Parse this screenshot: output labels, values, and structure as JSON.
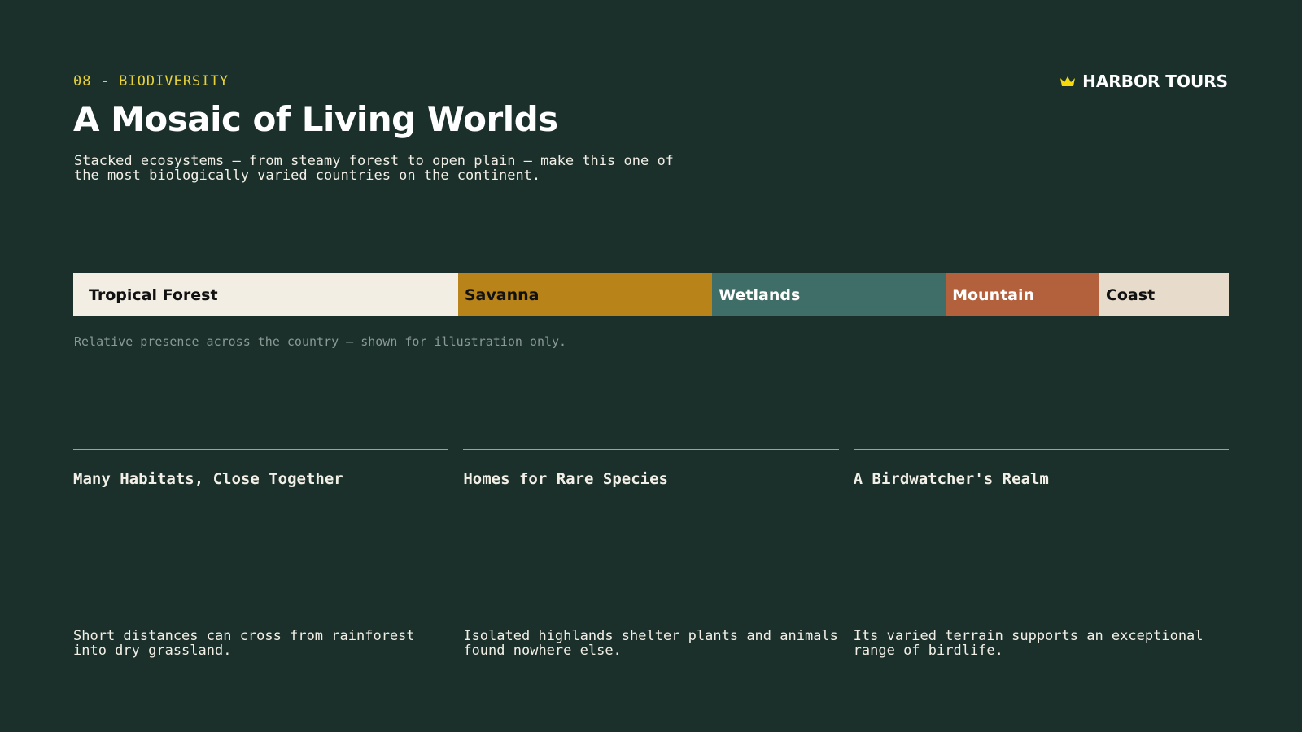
{
  "header": {
    "kicker": "08 - BIODIVERSITY",
    "title": "A Mosaic of Living Worlds",
    "subtitle": "Stacked ecosystems — from steamy forest to open plain — make this one of the most biologically varied countries on the continent."
  },
  "brand": {
    "icon": "crown-icon",
    "name": "HARBOR TOURS",
    "icon_color": "#f5d90a"
  },
  "chart_data": {
    "type": "bar",
    "categories": [
      "Tropical Forest",
      "Savanna",
      "Wetlands",
      "Mountain",
      "Coast"
    ],
    "values": [
      33.3,
      22,
      20.2,
      13.3,
      11.2
    ],
    "colors": [
      "#f2eee3",
      "#b88318",
      "#3e6e67",
      "#b3613d",
      "#e7dccb"
    ],
    "text_colors": [
      "#111111",
      "#111111",
      "#ffffff",
      "#ffffff",
      "#111111"
    ]
  },
  "caption": "Relative presence across the country — shown for illustration only.",
  "columns": [
    {
      "heading": "Many Habitats, Close Together",
      "body": "Short distances can cross from rainforest into dry grassland."
    },
    {
      "heading": "Homes for Rare Species",
      "body": "Isolated highlands shelter plants and animals found nowhere else."
    },
    {
      "heading": "A Birdwatcher's Realm",
      "body": "Its varied terrain supports an exceptional range of birdlife."
    }
  ]
}
